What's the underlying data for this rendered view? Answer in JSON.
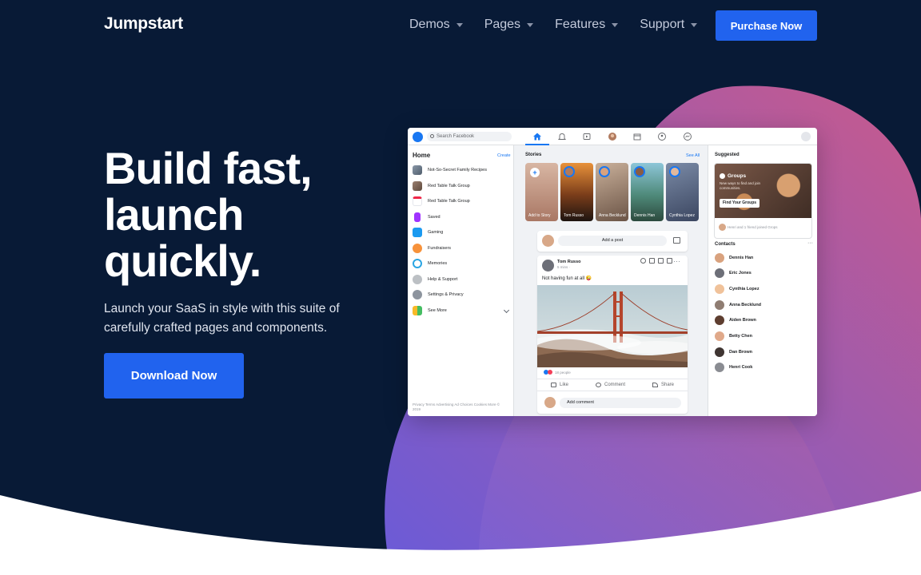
{
  "brand": {
    "name": "Jumpstart"
  },
  "nav": {
    "items": [
      {
        "label": "Demos"
      },
      {
        "label": "Pages"
      },
      {
        "label": "Features"
      },
      {
        "label": "Support"
      }
    ],
    "cta_label": "Purchase Now"
  },
  "hero": {
    "headline": "Build fast, launch quickly.",
    "subheadline": "Launch your SaaS in style with this suite of carefully crafted pages and components.",
    "cta_label": "Download Now"
  },
  "colors": {
    "background": "#081a36",
    "accent": "#2163ee",
    "blob_start": "#6a5bd8",
    "blob_end": "#c85a8c"
  },
  "mockup": {
    "search_placeholder": "Search Facebook",
    "left": {
      "title": "Home",
      "create_label": "Create",
      "items": [
        {
          "label": "Not-So-Secret Family Recipes",
          "icon": "group-photo-icon"
        },
        {
          "label": "Red Table Talk Group",
          "icon": "group-photo-icon"
        },
        {
          "label": "Red Table Talk Group",
          "icon": "calendar-icon"
        },
        {
          "label": "Saved",
          "icon": "bookmark-icon"
        },
        {
          "label": "Gaming",
          "icon": "gaming-icon"
        },
        {
          "label": "Fundraisers",
          "icon": "fundraiser-icon"
        },
        {
          "label": "Memories",
          "icon": "memories-icon"
        },
        {
          "label": "Help & Support",
          "icon": "help-icon"
        },
        {
          "label": "Settings & Privacy",
          "icon": "settings-icon"
        },
        {
          "label": "See More",
          "icon": "see-more-icon"
        }
      ],
      "footer": "Privacy  Terms  Advertising  Ad Choices  Cookies  More  © 2019"
    },
    "stories": {
      "title": "Stories",
      "see_all": "See All",
      "items": [
        {
          "name": "Add to Story"
        },
        {
          "name": "Tom Russo"
        },
        {
          "name": "Anna Becklund"
        },
        {
          "name": "Dennis Han"
        },
        {
          "name": "Cynthia Lopez"
        }
      ]
    },
    "add_post": "Add a post",
    "post": {
      "author": "Tom Russo",
      "time": "5 mins · ",
      "text": "Not having fun at all 😜",
      "reactions": "18 people",
      "like": "Like",
      "comment": "Comment",
      "share": "Share",
      "comment_placeholder": "Add comment"
    },
    "right": {
      "suggested_title": "Suggested",
      "groups_title": "Groups",
      "groups_desc": "New ways to find and join communities.",
      "find_groups": "Find Your Groups",
      "joined": "Henri and 1 friend joined Grops",
      "contacts_title": "Contacts",
      "contacts": [
        {
          "name": "Dennis Han"
        },
        {
          "name": "Eric Jones"
        },
        {
          "name": "Cynthia Lopez"
        },
        {
          "name": "Anna Becklund"
        },
        {
          "name": "Aiden Brown"
        },
        {
          "name": "Betty Chen"
        },
        {
          "name": "Dan Brown"
        },
        {
          "name": "Henri Cook"
        }
      ]
    }
  }
}
